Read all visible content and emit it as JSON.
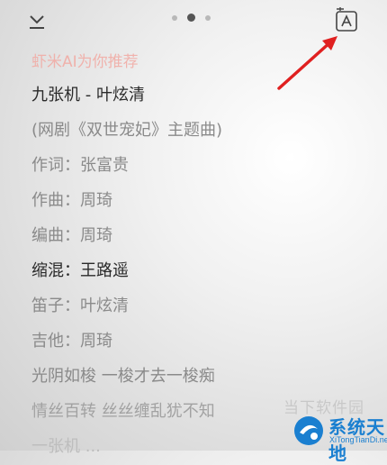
{
  "topbar": {
    "page_indicator": {
      "count": 3,
      "active": 2
    },
    "collapse_icon": "chevron-down-line-icon",
    "translate_icon": "translate-icon"
  },
  "annotation": {
    "arrow_color": "#e02020"
  },
  "lyrics": {
    "recommend_text": "虾米AI为你推荐",
    "lines": [
      "九张机 - 叶炫清",
      "(网剧《双世宠妃》主题曲)",
      "作词：张富贵",
      "作曲：周琦",
      "编曲：周琦",
      "缩混：王路遥",
      "笛子：叶炫清",
      "吉他：周琦",
      "光阴如梭 一梭才去一梭痴",
      "情丝百转 丝丝缠乱犹不知",
      "一张机 ..."
    ]
  },
  "watermark": {
    "text_top": "当下软件园",
    "brand": "系统天地",
    "url": "XiTongTianDi.net"
  }
}
